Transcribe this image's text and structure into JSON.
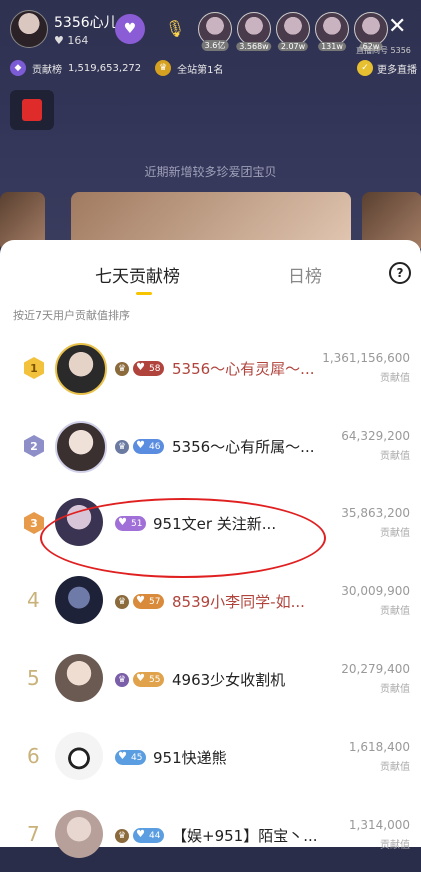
{
  "host": {
    "name": "5356心儿",
    "likes": "164"
  },
  "viewers": [
    {
      "badge": "3.6亿"
    },
    {
      "badge": "3.568w"
    },
    {
      "badge": "2.07w"
    },
    {
      "badge": "131w"
    },
    {
      "badge": "62w"
    }
  ],
  "room_no": "直播间号 5356",
  "contribution": {
    "label": "贡献榜",
    "value": "1,519,653,272"
  },
  "site_rank": "全站第1名",
  "more_live": "更多直播",
  "tip": "近期新增较多珍爱团宝贝",
  "tabs": {
    "seven_day": "七天贡献榜",
    "daily": "日榜"
  },
  "subtitle": "按近7天用户贡献值排序",
  "score_label": "贡献值",
  "ranks": [
    {
      "rank": "1",
      "level": "58",
      "name": "5356～心有灵犀～...",
      "score": "1,361,156,600",
      "name_color": "#b0443c",
      "badge_color": "#c0683f"
    },
    {
      "rank": "2",
      "level": "46",
      "name": "5356～心有所属～...",
      "score": "64,329,200",
      "name_color": "#222222",
      "badge_color": "#5a8de0"
    },
    {
      "rank": "3",
      "level": "51",
      "name": "951文er 关注新...",
      "score": "35,863,200",
      "name_color": "#222222",
      "badge_color": "#a070d8"
    },
    {
      "rank": "4",
      "level": "57",
      "name": "8539小李同学-如...",
      "score": "30,009,900",
      "name_color": "#b0443c",
      "badge_color": "#d98a3a"
    },
    {
      "rank": "5",
      "level": "55",
      "name": "4963少女收割机",
      "score": "20,279,400",
      "name_color": "#222222",
      "badge_color": "#e0a24a"
    },
    {
      "rank": "6",
      "level": "45",
      "name": "951快递熊",
      "score": "1,618,400",
      "name_color": "#222222",
      "badge_color": "#5a9de0"
    },
    {
      "rank": "7",
      "level": "44",
      "name": "【娱+951】陌宝丶...",
      "score": "1,314,000",
      "name_color": "#222222",
      "badge_color": "#5a9de0"
    }
  ]
}
